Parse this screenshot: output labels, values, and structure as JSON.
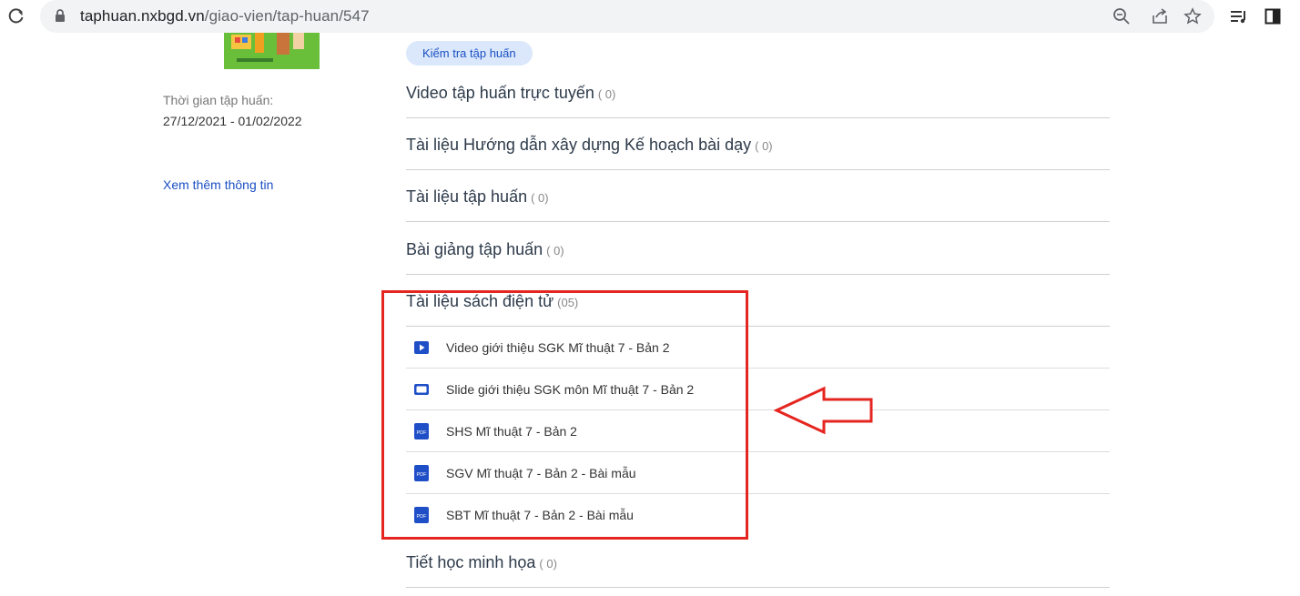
{
  "browser": {
    "url_host": "taphuan.nxbgd.vn",
    "url_path": "/giao-vien/tap-huan/547"
  },
  "sidebar": {
    "time_label": "Thời gian tập huấn:",
    "time_value": "27/12/2021 - 01/02/2022",
    "more_link": "Xem thêm thông tin"
  },
  "main": {
    "check_button": "Kiểm tra tập huấn",
    "sections": [
      {
        "title": "Video tập huấn trực tuyến",
        "count": "( 0)"
      },
      {
        "title": "Tài liệu Hướng dẫn xây dựng Kế hoạch bài dạy",
        "count": "( 0)"
      },
      {
        "title": "Tài liệu tập huấn",
        "count": "( 0)"
      },
      {
        "title": "Bài giảng tập huấn",
        "count": "( 0)"
      },
      {
        "title": "Tài liệu sách điện tử",
        "count": "(05)"
      },
      {
        "title": "Tiết học minh họa",
        "count": "( 0)"
      }
    ],
    "ebook_items": [
      {
        "label": "Video giới thiệu SGK Mĩ thuật 7 - Bản 2",
        "icon": "video-play-icon"
      },
      {
        "label": "Slide giới thiệu SGK môn Mĩ thuật 7 - Bản 2",
        "icon": "slide-icon"
      },
      {
        "label": "SHS Mĩ thuật 7 - Bản 2",
        "icon": "pdf-icon"
      },
      {
        "label": "SGV Mĩ thuật 7 - Bản 2 - Bài mẫu",
        "icon": "pdf-icon"
      },
      {
        "label": "SBT Mĩ thuật 7 - Bản 2 - Bài mẫu",
        "icon": "pdf-icon"
      }
    ],
    "pdf_badge": "PDF"
  },
  "colors": {
    "accent_blue": "#1a4fc4",
    "highlight_red": "#e52620"
  }
}
